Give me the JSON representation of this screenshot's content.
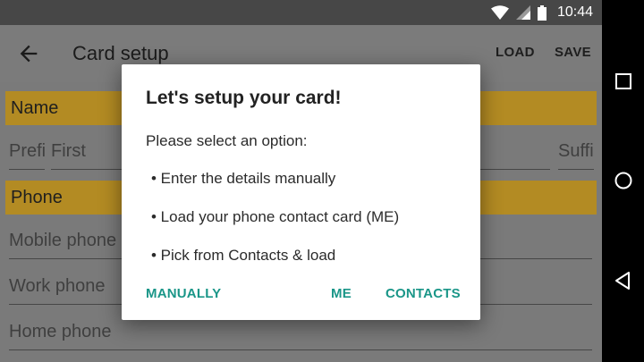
{
  "status_bar": {
    "time": "10:44",
    "icons": [
      "wifi-icon",
      "cell-signal-icon",
      "battery-icon"
    ]
  },
  "app_bar": {
    "title": "Card setup",
    "actions": {
      "load": "LOAD",
      "save": "SAVE"
    }
  },
  "form": {
    "name_section": "Name",
    "prefix_placeholder": "Prefix",
    "first_placeholder": "First",
    "suffix_placeholder": "Suffix",
    "phone_section": "Phone",
    "mobile_placeholder": "Mobile phone",
    "work_placeholder": "Work phone",
    "home_placeholder": "Home phone"
  },
  "dialog": {
    "title": "Let's setup your card!",
    "message": "Please select an option:",
    "options": [
      "• Enter the details manually",
      "• Load your phone contact card (ME)",
      "• Pick from Contacts & load"
    ],
    "buttons": {
      "manually": "MANUALLY",
      "me": "ME",
      "contacts": "CONTACTS"
    }
  },
  "colors": {
    "accent": "#1a9688",
    "section_header": "#b38b23",
    "status_bar": "#474747"
  },
  "nav_bar": {
    "icons": [
      "recent-apps-icon",
      "home-icon",
      "back-nav-icon"
    ]
  }
}
